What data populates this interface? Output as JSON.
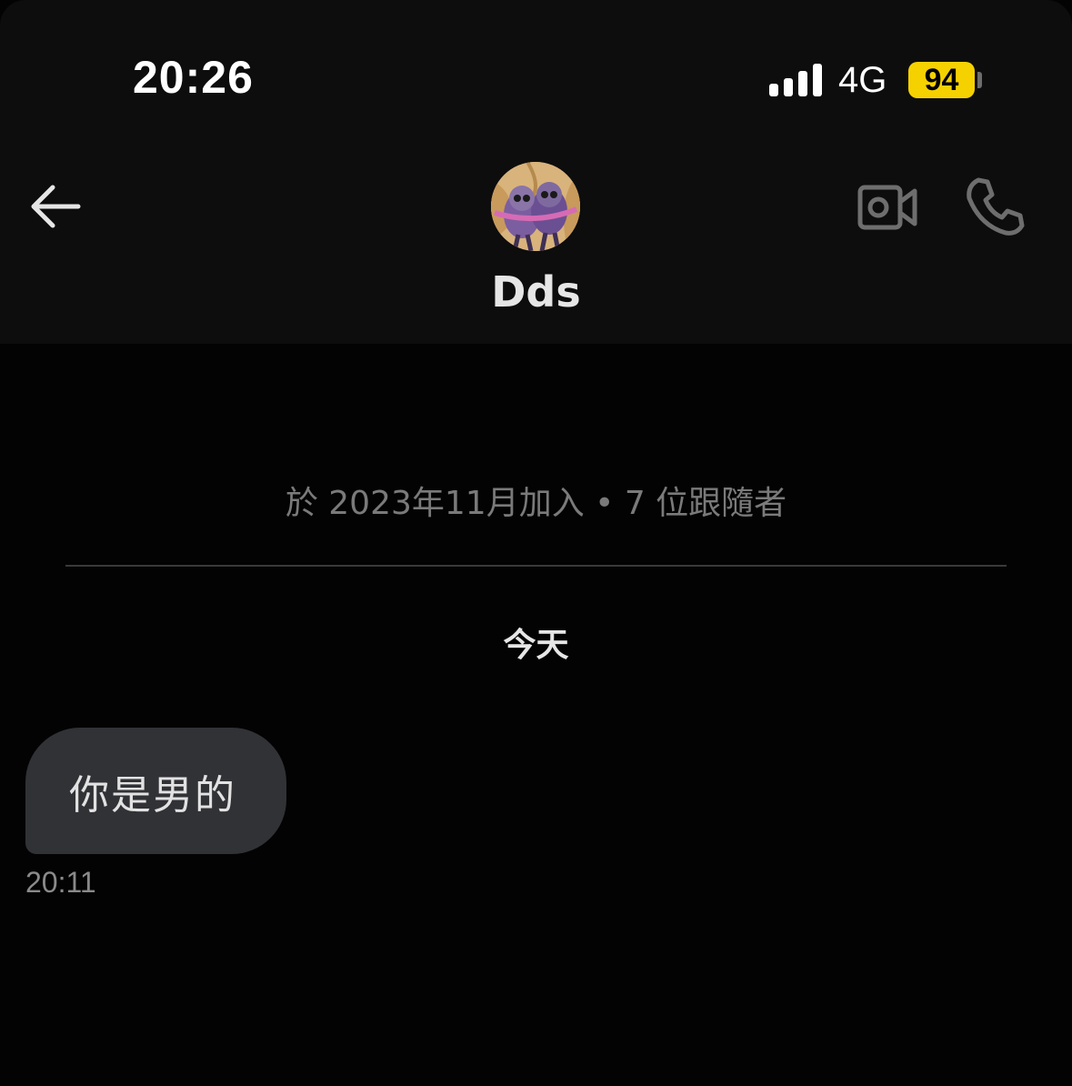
{
  "status_bar": {
    "time": "20:26",
    "network": "4G",
    "battery_level": "94",
    "battery_color": "#f6d100",
    "signal_bars": 4
  },
  "header": {
    "contact_name": "Dds",
    "back_icon": "arrow-left-icon",
    "video_icon": "video-camera-icon",
    "call_icon": "phone-icon"
  },
  "conversation": {
    "join_info": "於 2023年11月加入 • 7 位跟隨者",
    "date_label": "今天",
    "messages": [
      {
        "text": "你是男的",
        "time": "20:11",
        "direction": "incoming"
      }
    ]
  },
  "colors": {
    "background": "#030303",
    "header_background": "#0d0d0d",
    "bubble": "#313236",
    "muted_text": "#7a7a7a"
  }
}
